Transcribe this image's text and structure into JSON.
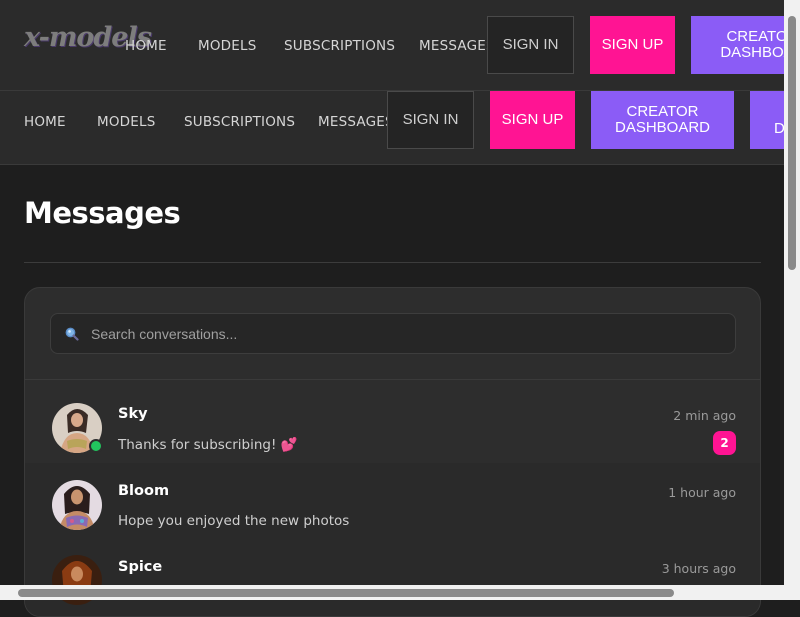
{
  "header": {
    "logo_text": "x-models",
    "nav": [
      "HOME",
      "MODELS",
      "SUBSCRIPTIONS",
      "MESSAGES"
    ],
    "sign_in": "SIGN IN",
    "sign_up": "SIGN UP",
    "creator_dashboard": "CREATOR DASHBOARD",
    "creator_dashboard_cut": "CREATO DASHBOA",
    "extra_button_cut": "D"
  },
  "page": {
    "title": "Messages"
  },
  "search": {
    "placeholder": "Search conversations...",
    "value": ""
  },
  "conversations": [
    {
      "name": "Sky",
      "time": "2 min ago",
      "preview": "Thanks for subscribing! 💕",
      "unread": "2",
      "online": true
    },
    {
      "name": "Bloom",
      "time": "1 hour ago",
      "preview": "Hope you enjoyed the new photos",
      "unread": "",
      "online": false
    },
    {
      "name": "Spice",
      "time": "3 hours ago",
      "preview": "",
      "unread": "",
      "online": false
    }
  ],
  "colors": {
    "accent_pink": "#ff1493",
    "accent_purple": "#8b5cf6",
    "online": "#22c55e"
  },
  "icons": {
    "search": "magnifier-icon"
  }
}
